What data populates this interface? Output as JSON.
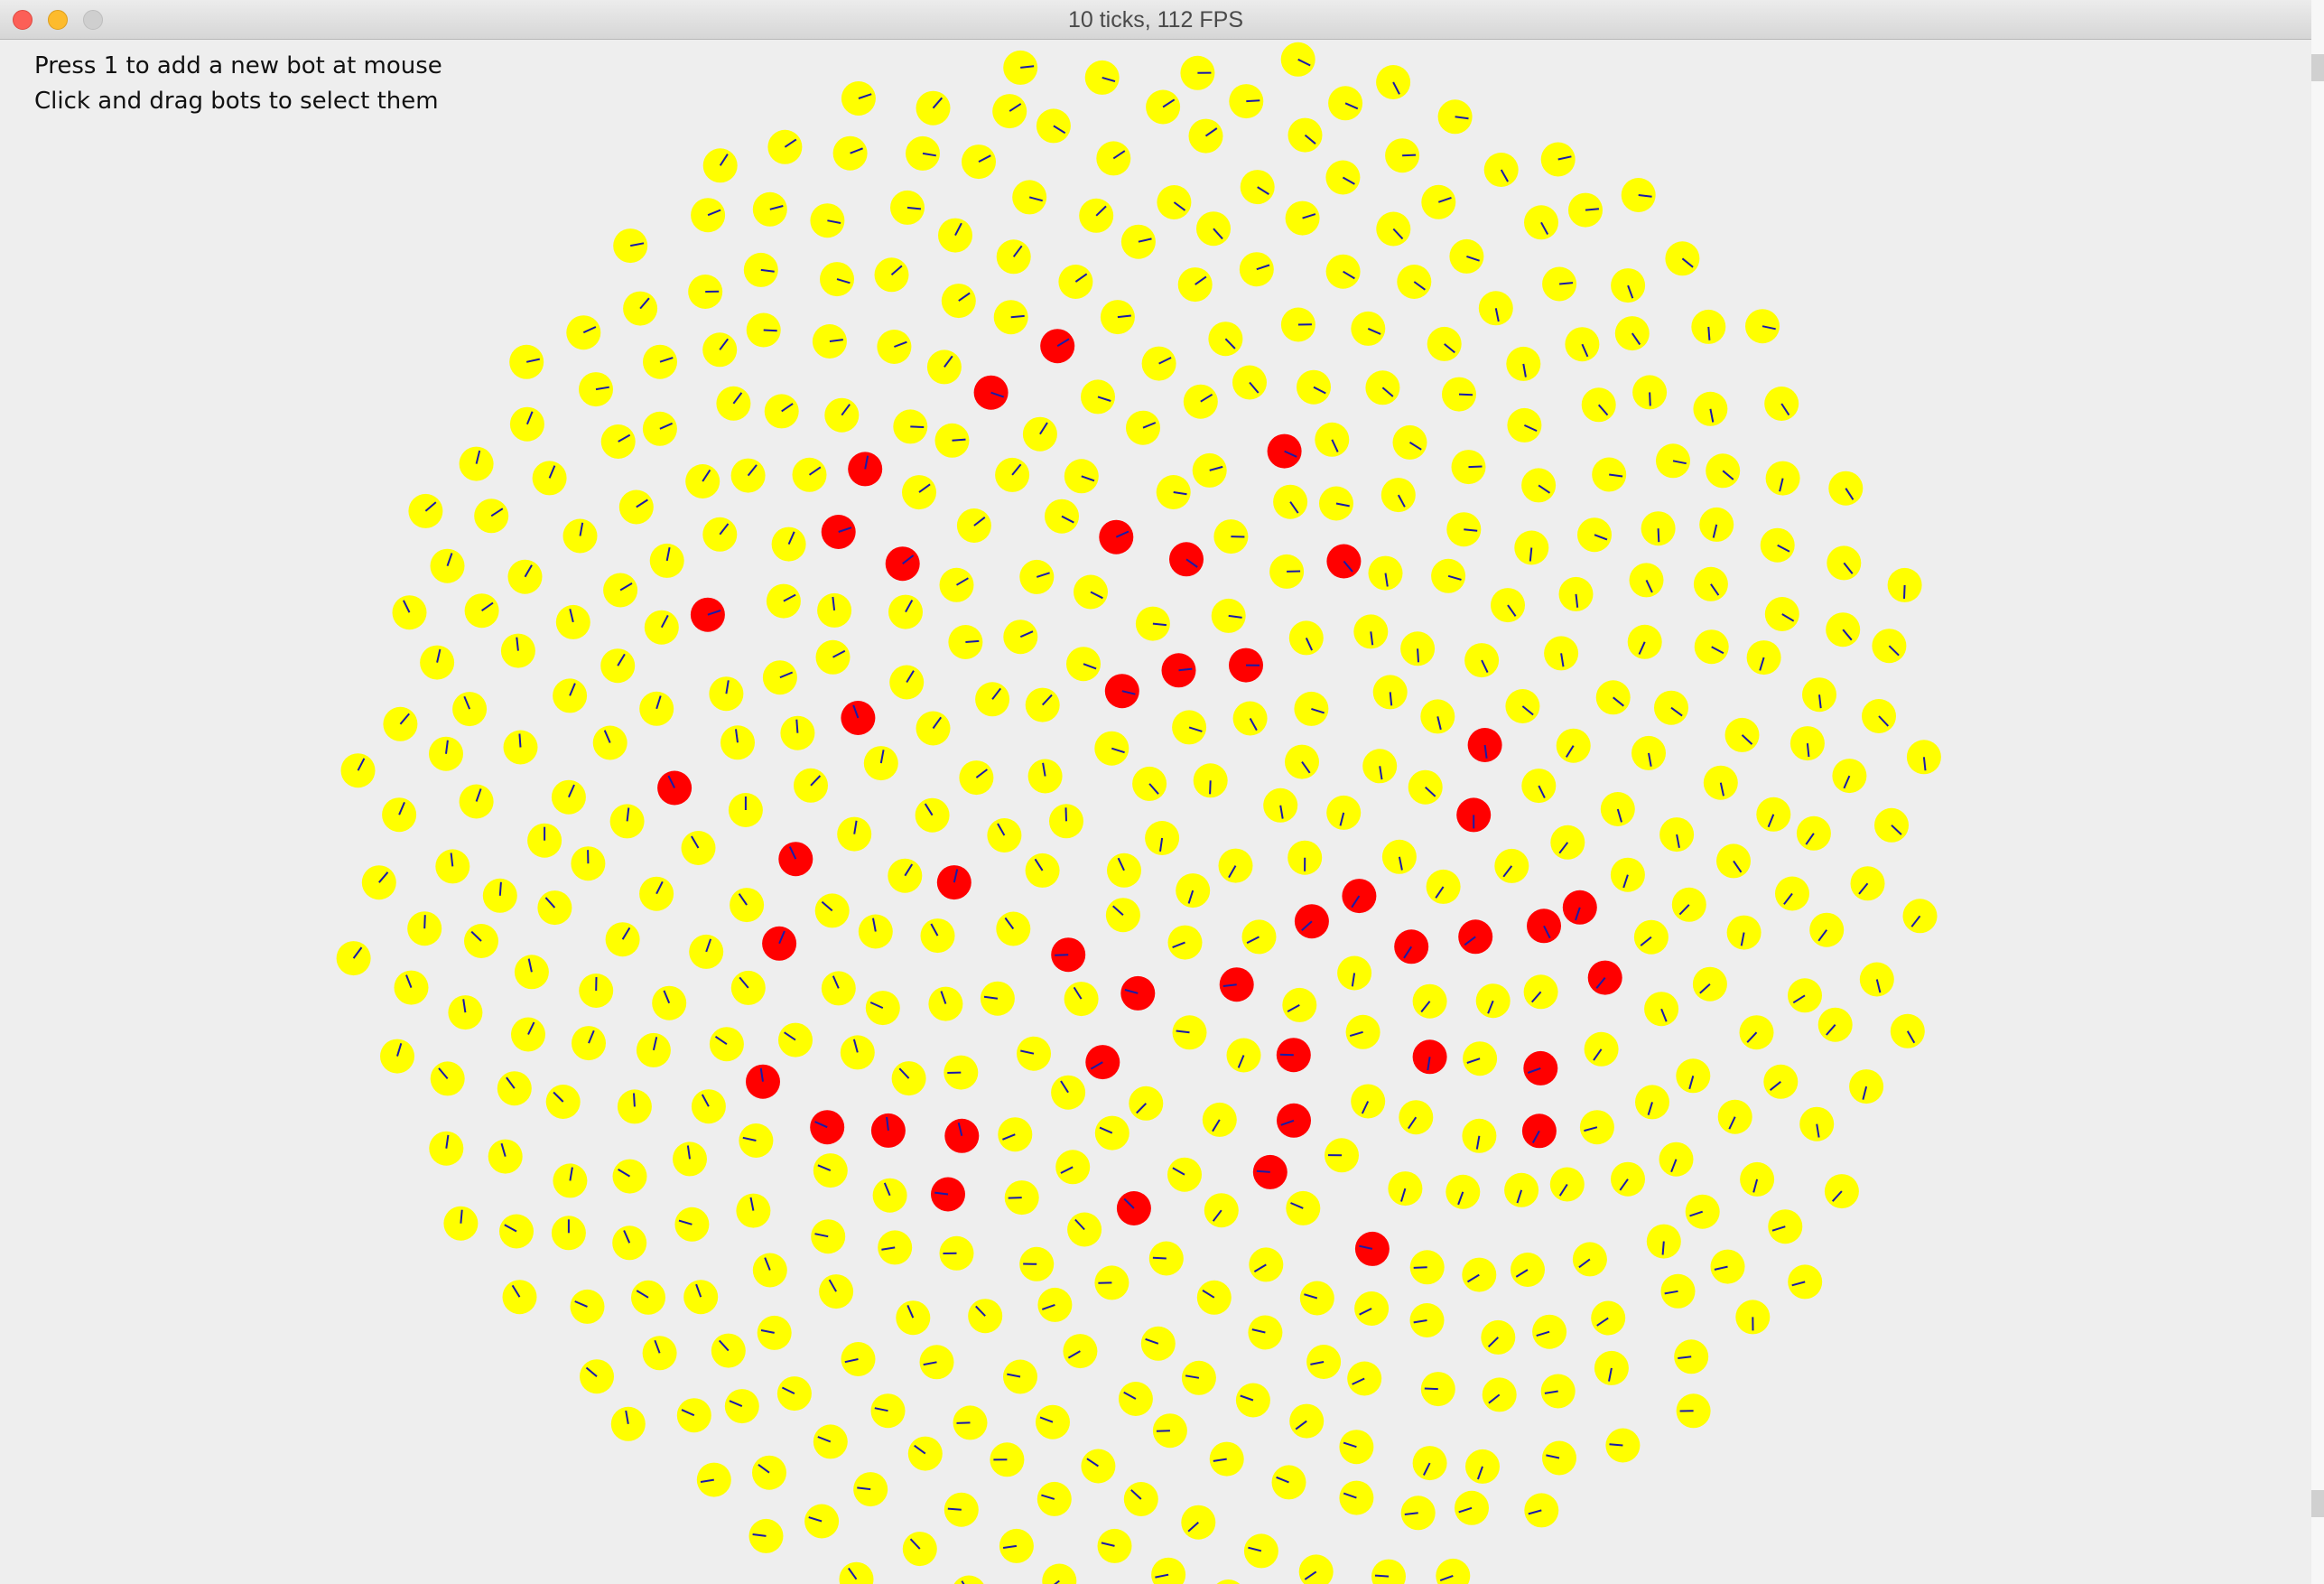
{
  "window": {
    "title": "10 ticks, 112 FPS"
  },
  "instructions": {
    "line1": "Press 1 to add a new bot at mouse",
    "line2": "Click and drag bots to select them"
  },
  "colors": {
    "bot_normal": "#ffff00",
    "bot_selected": "#ff0000",
    "heading_line": "#1a1aa8",
    "background": "#eeeeee"
  },
  "simulation": {
    "total_bots_approx": 520,
    "selected_bots_approx": 44
  }
}
